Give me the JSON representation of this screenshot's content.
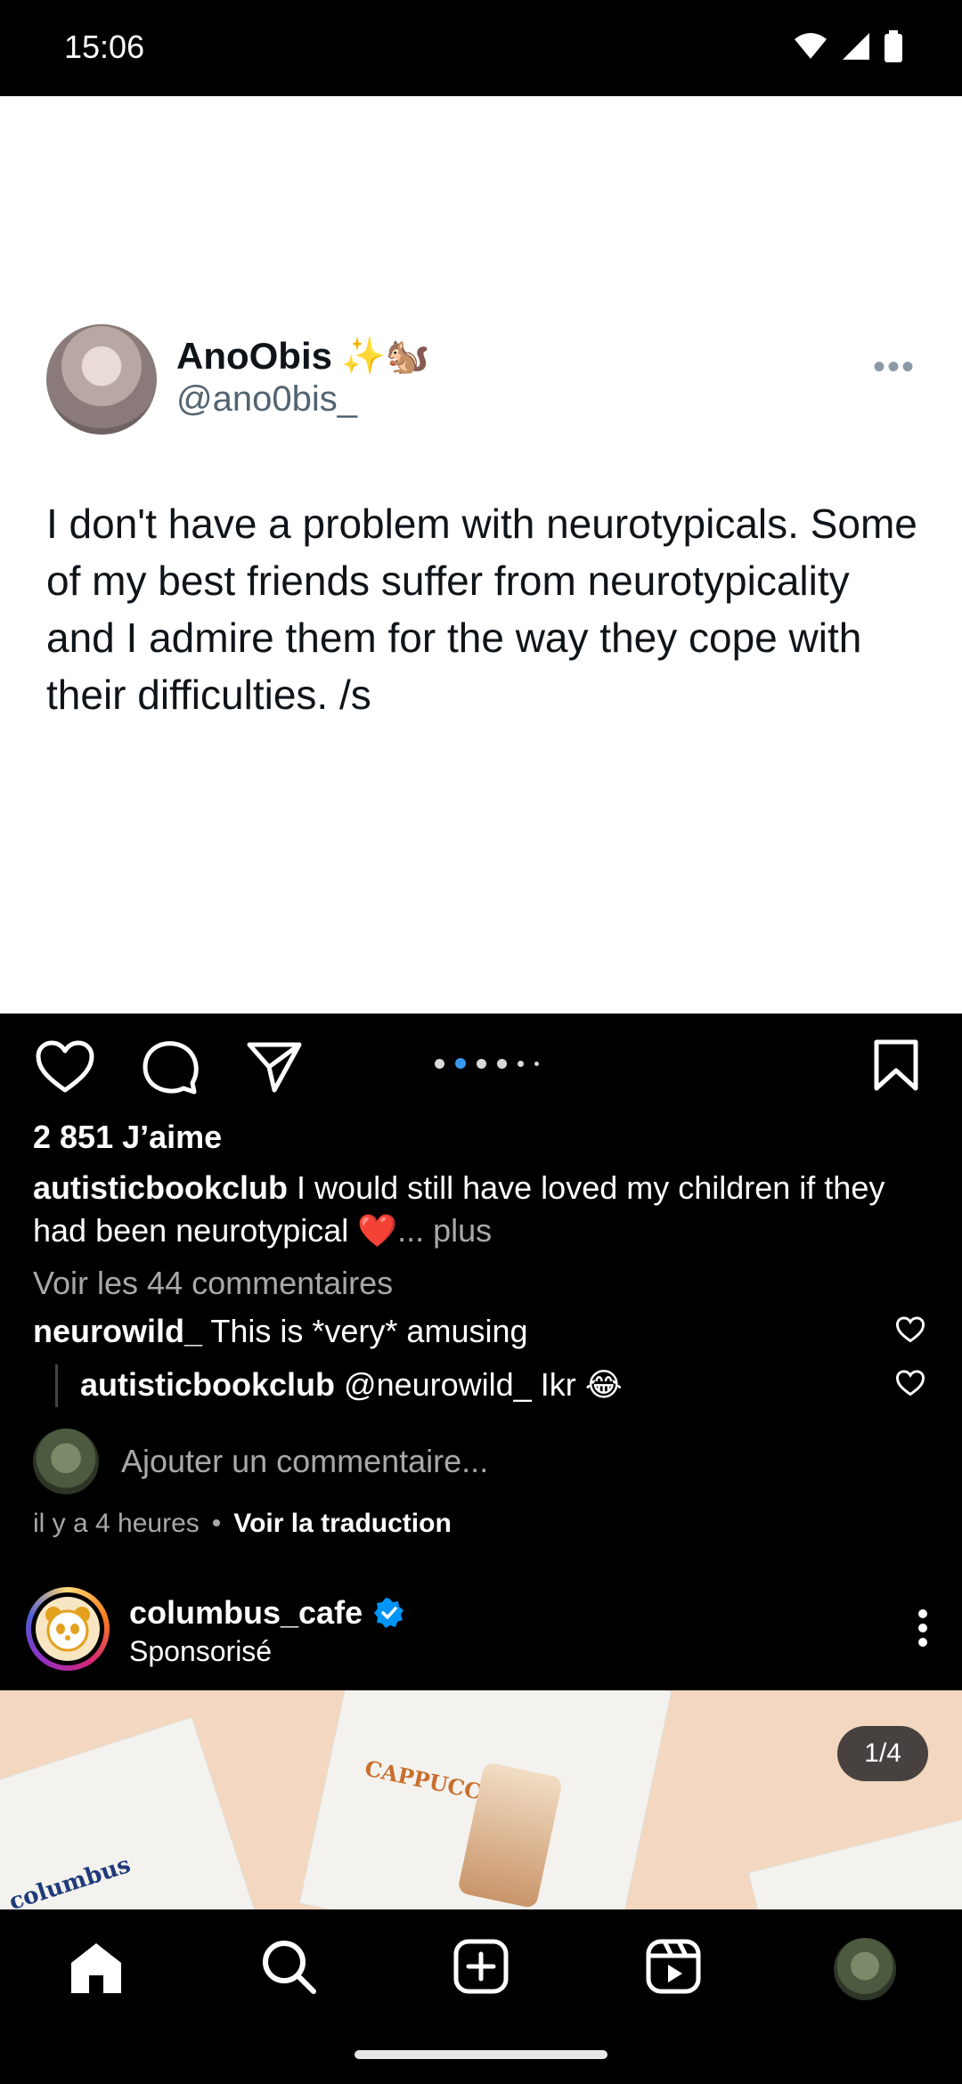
{
  "status_bar": {
    "time": "15:06"
  },
  "tweet": {
    "display_name": "AnoObis",
    "name_emojis": "✨🐿️",
    "handle": "@ano0bis_",
    "text": "I don't have a problem with neurotypicals. Some of my best friends suffer from neurotypicality and I admire them for the way they cope with their difficulties. /s",
    "more_icon": "ellipsis-icon"
  },
  "post": {
    "likes": "2 851 J’aime",
    "caption_user": "autisticbookclub",
    "caption_text": "I would still have loved my children if they had been neurotypical ❤️",
    "caption_more": "... plus",
    "view_comments": "Voir les 44 commentaires",
    "comments": [
      {
        "user": "neurowild_",
        "text": "This is *very* amusing"
      },
      {
        "user": "autisticbookclub",
        "text": "@neurowild_ Ikr 😂"
      }
    ],
    "add_comment_placeholder": "Ajouter un commentaire...",
    "time_ago": "il y a 4 heures",
    "separator": "•",
    "translate": "Voir la traduction",
    "carousel": {
      "count": 6,
      "active_index": 1
    }
  },
  "sponsored": {
    "account": "columbus_cafe",
    "label": "Sponsorisé",
    "verified": true,
    "counter": "1/4",
    "box_label": "CAPPUCCINO",
    "box_brand": "columbus"
  },
  "bottom_nav": {
    "items": [
      "home-icon",
      "search-icon",
      "create-icon",
      "reels-icon",
      "profile-avatar"
    ]
  },
  "colors": {
    "accent": "#3897f0",
    "verified": "#0095f6",
    "muted": "#a8a8a8"
  }
}
